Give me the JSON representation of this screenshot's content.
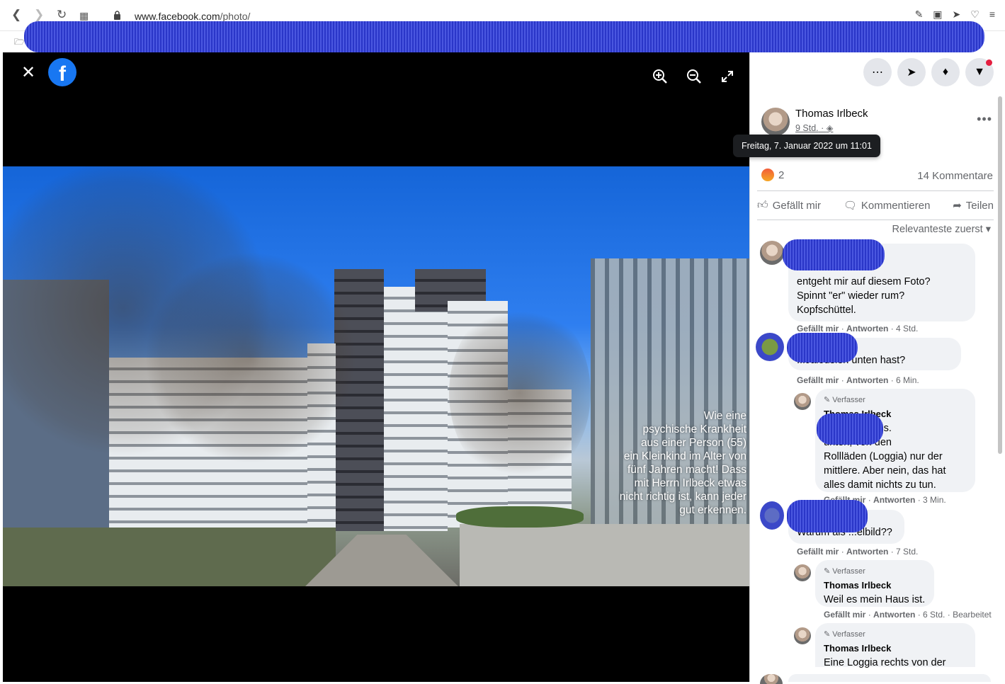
{
  "browser": {
    "url_domain": "www.facebook.com",
    "url_path": "/photo/"
  },
  "viewer": {
    "logo": "f",
    "caption": "Wie eine\npsychische Krankheit\naus einer Person (55)\nein Kleinkind im Alter von\nfünf Jahren macht! Dass\nmit Herrn Irlbeck etwas\nnicht richtig ist, kann jeder\ngut erkennen."
  },
  "post": {
    "author": "Thomas Irlbeck",
    "time": "9 Std.",
    "tooltip": "Freitag, 7. Januar 2022 um 11:01",
    "reaction_count": "2",
    "comments_count": "14 Kommentare",
    "actions": {
      "like": "Gefällt mir",
      "comment": "Kommentieren",
      "share": "Teilen"
    },
    "sort": "Relevanteste zuerst"
  },
  "comments": [
    {
      "text": "...ts. Oder was\nentgeht mir auf diesem Foto?\nSpinnt \"er\" wieder rum?\nKopfschüttel.",
      "like": "Gefällt mir",
      "reply": "Antworten",
      "time": "4 Std."
    },
    {
      "text": "...Jalousien unten hast?",
      "like": "Gefällt mir",
      "reply": "Antworten",
      "time": "6 Min."
    },
    {
      "badge": "Verfasser",
      "name": "Thomas Irlbeck",
      "text": "Es sind Rollos.\nunten, von den\nRollläden (Loggia) nur der\nmittlere. Aber nein, das hat\nalles damit nichts zu tun.",
      "like": "Gefällt mir",
      "reply": "Antworten",
      "time": "3 Min."
    },
    {
      "text": "Warum als ...elbild??",
      "like": "Gefällt mir",
      "reply": "Antworten",
      "time": "7 Std."
    },
    {
      "badge": "Verfasser",
      "name": "Thomas Irlbeck",
      "text": "Weil es mein Haus ist.",
      "like": "Gefällt mir",
      "reply": "Antworten",
      "time": "6 Std.",
      "edited": "Bearbeitet"
    },
    {
      "badge": "Verfasser",
      "name": "Thomas Irlbeck",
      "text": "Eine Loggia rechts von der"
    }
  ]
}
